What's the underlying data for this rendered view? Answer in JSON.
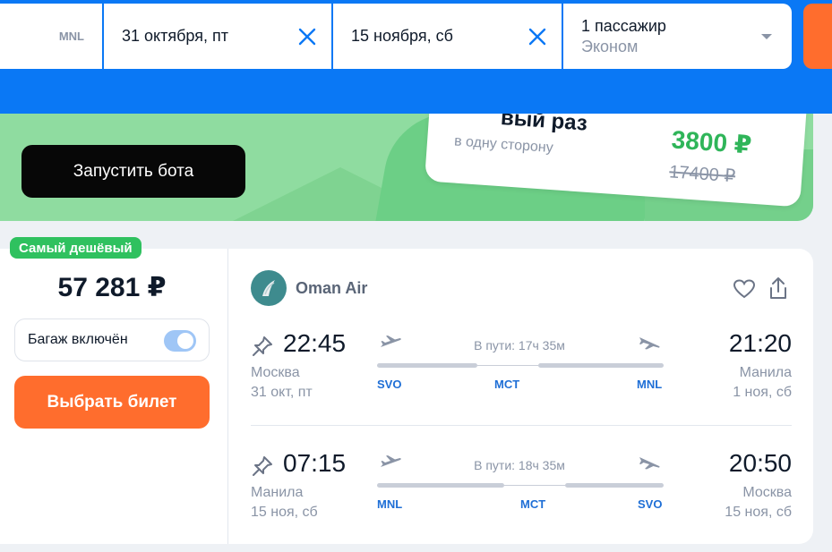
{
  "search": {
    "destination_code": "MNL",
    "depart_date": "31 октября, пт",
    "return_date": "15 ноября, сб",
    "passengers": "1 пассажир",
    "cabin_class": "Эконом"
  },
  "promo": {
    "bot_button": "Запустить бота",
    "card_title_fragment": "вый раз",
    "card_subtitle": "в одну сторону",
    "price_new": "3800 ₽",
    "price_old": "17400 ₽"
  },
  "ticket": {
    "badge": "Самый дешёвый",
    "price": "57 281 ₽",
    "baggage_label": "Багаж включён",
    "baggage_included": true,
    "choose_button": "Выбрать билет",
    "airline": "Oman Air",
    "legs": [
      {
        "dep_time": "22:45",
        "dep_city": "Москва",
        "dep_date": "31 окт, пт",
        "duration": "В пути: 17ч 35м",
        "arr_time": "21:20",
        "arr_city": "Манила",
        "arr_date": "1 ноя, сб",
        "airports": [
          "SVO",
          "MCT",
          "MNL"
        ]
      },
      {
        "dep_time": "07:15",
        "dep_city": "Манила",
        "dep_date": "15 ноя, сб",
        "duration": "В пути: 18ч 35м",
        "arr_time": "20:50",
        "arr_city": "Москва",
        "arr_date": "15 ноя, сб",
        "airports": [
          "MNL",
          "MCT",
          "SVO"
        ]
      }
    ]
  },
  "colors": {
    "brand_blue": "#0a78f5",
    "accent_orange": "#ff6d2d",
    "promo_green": "#8fdca0",
    "badge_green": "#2fc15f",
    "airport_blue": "#1f6fd6"
  },
  "icons": [
    "clear-icon",
    "dropdown-caret-icon",
    "airline-logo-icon",
    "heart-icon",
    "share-icon",
    "pin-icon",
    "takeoff-icon",
    "landing-icon"
  ]
}
